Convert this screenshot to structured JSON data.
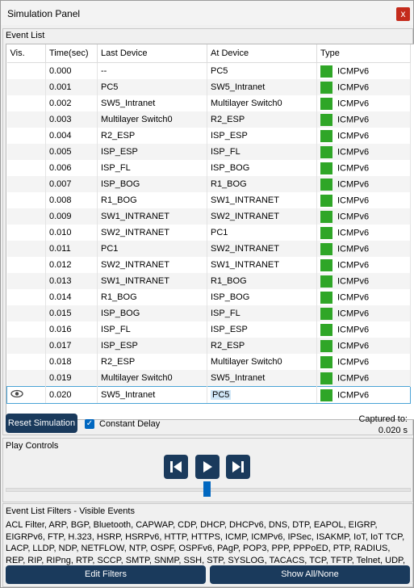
{
  "window": {
    "title": "Simulation Panel",
    "close_glyph": "x"
  },
  "event_list": {
    "label": "Event List",
    "columns": [
      "Vis.",
      "Time(sec)",
      "Last Device",
      "At Device",
      "Type"
    ],
    "type_color": "#2fa627",
    "rows": [
      {
        "time": "0.000",
        "last": "--",
        "at": "PC5",
        "type": "ICMPv6"
      },
      {
        "time": "0.001",
        "last": "PC5",
        "at": "SW5_Intranet",
        "type": "ICMPv6"
      },
      {
        "time": "0.002",
        "last": "SW5_Intranet",
        "at": "Multilayer Switch0",
        "type": "ICMPv6"
      },
      {
        "time": "0.003",
        "last": "Multilayer Switch0",
        "at": "R2_ESP",
        "type": "ICMPv6"
      },
      {
        "time": "0.004",
        "last": "R2_ESP",
        "at": "ISP_ESP",
        "type": "ICMPv6"
      },
      {
        "time": "0.005",
        "last": "ISP_ESP",
        "at": "ISP_FL",
        "type": "ICMPv6"
      },
      {
        "time": "0.006",
        "last": "ISP_FL",
        "at": "ISP_BOG",
        "type": "ICMPv6"
      },
      {
        "time": "0.007",
        "last": "ISP_BOG",
        "at": "R1_BOG",
        "type": "ICMPv6"
      },
      {
        "time": "0.008",
        "last": "R1_BOG",
        "at": "SW1_INTRANET",
        "type": "ICMPv6"
      },
      {
        "time": "0.009",
        "last": "SW1_INTRANET",
        "at": "SW2_INTRANET",
        "type": "ICMPv6"
      },
      {
        "time": "0.010",
        "last": "SW2_INTRANET",
        "at": "PC1",
        "type": "ICMPv6"
      },
      {
        "time": "0.011",
        "last": "PC1",
        "at": "SW2_INTRANET",
        "type": "ICMPv6"
      },
      {
        "time": "0.012",
        "last": "SW2_INTRANET",
        "at": "SW1_INTRANET",
        "type": "ICMPv6"
      },
      {
        "time": "0.013",
        "last": "SW1_INTRANET",
        "at": "R1_BOG",
        "type": "ICMPv6"
      },
      {
        "time": "0.014",
        "last": "R1_BOG",
        "at": "ISP_BOG",
        "type": "ICMPv6"
      },
      {
        "time": "0.015",
        "last": "ISP_BOG",
        "at": "ISP_FL",
        "type": "ICMPv6"
      },
      {
        "time": "0.016",
        "last": "ISP_FL",
        "at": "ISP_ESP",
        "type": "ICMPv6"
      },
      {
        "time": "0.017",
        "last": "ISP_ESP",
        "at": "R2_ESP",
        "type": "ICMPv6"
      },
      {
        "time": "0.018",
        "last": "R2_ESP",
        "at": "Multilayer Switch0",
        "type": "ICMPv6"
      },
      {
        "time": "0.019",
        "last": "Multilayer Switch0",
        "at": "SW5_Intranet",
        "type": "ICMPv6"
      },
      {
        "time": "0.020",
        "last": "SW5_Intranet",
        "at": "PC5",
        "type": "ICMPv6",
        "selected": true,
        "vis_icon": "eye-icon"
      }
    ]
  },
  "controls": {
    "reset_label": "Reset Simulation",
    "constant_delay_label": "Constant Delay",
    "constant_delay_checked": true,
    "captured_label": "Captured to:",
    "captured_value": "0.020 s"
  },
  "play_controls": {
    "label": "Play Controls",
    "buttons": [
      "back-icon",
      "play-icon",
      "forward-icon"
    ],
    "slider_position": 0.5
  },
  "filters": {
    "label": "Event List Filters - Visible Events",
    "text": "ACL Filter, ARP, BGP, Bluetooth, CAPWAP, CDP, DHCP, DHCPv6, DNS, DTP, EAPOL, EIGRP, EIGRPv6, FTP, H.323, HSRP, HSRPv6, HTTP, HTTPS, ICMP, ICMPv6, IPSec, ISAKMP, IoT, IoT TCP, LACP, LLDP, NDP, NETFLOW, NTP, OSPF, OSPFv6, PAgP, POP3, PPP, PPPoED, PTP, RADIUS, REP, RIP, RIPng, RTP, SCCP, SMTP, SNMP, SSH, STP, SYSLOG, TACACS, TCP, TFTP, Telnet, UDP, USB, VTP",
    "edit_label": "Edit Filters",
    "show_all_label": "Show All/None"
  }
}
